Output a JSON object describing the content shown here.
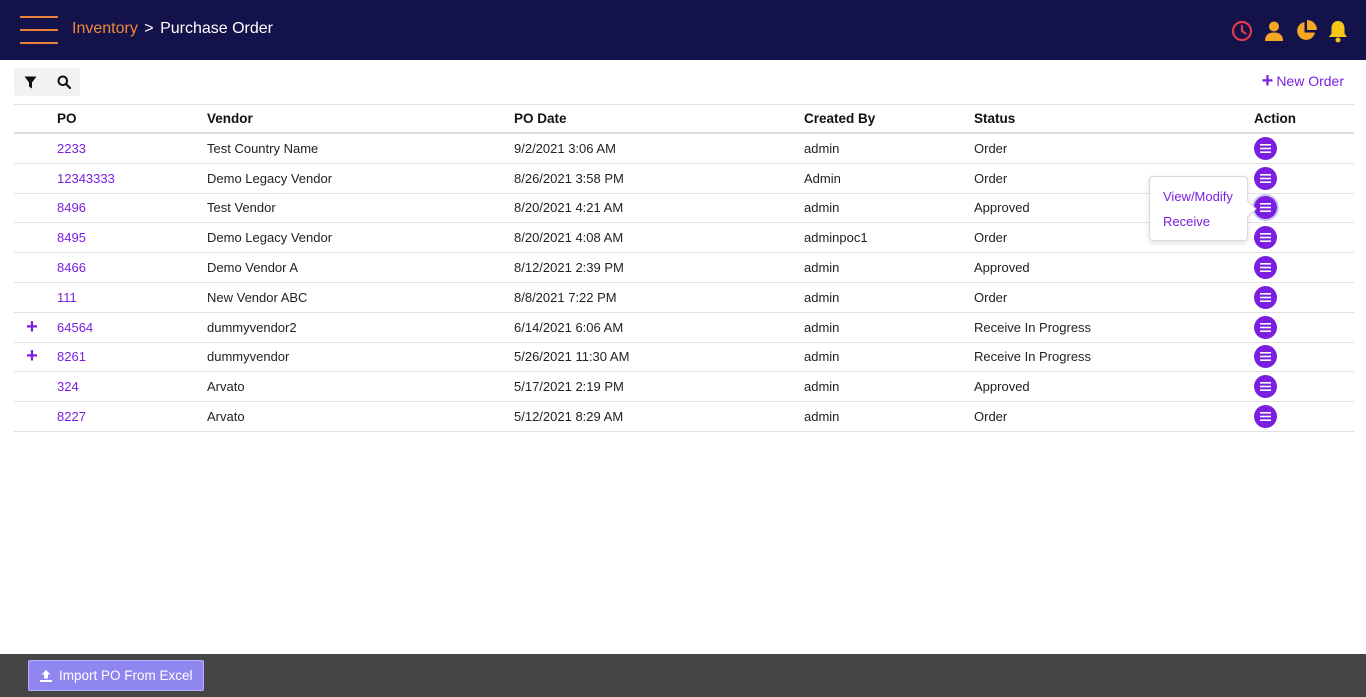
{
  "header": {
    "breadcrumb_parent": "Inventory",
    "breadcrumb_separator": ">",
    "breadcrumb_current": "Purchase Order",
    "icons": [
      "clock-icon",
      "user-icon",
      "pie-chart-icon",
      "bell-icon"
    ]
  },
  "toolbar": {
    "filter_icon": "filter-icon",
    "search_icon": "search-icon",
    "new_order_label": "New Order"
  },
  "table": {
    "columns": [
      "PO",
      "Vendor",
      "PO Date",
      "Created By",
      "Status",
      "Action"
    ],
    "rows": [
      {
        "po": "2233",
        "vendor": "Test Country Name",
        "date": "9/2/2021 3:06 AM",
        "created_by": "admin",
        "status": "Order",
        "expandable": false
      },
      {
        "po": "12343333",
        "vendor": "Demo Legacy Vendor",
        "date": "8/26/2021 3:58 PM",
        "created_by": "Admin",
        "status": "Order",
        "expandable": false
      },
      {
        "po": "8496",
        "vendor": "Test Vendor",
        "date": "8/20/2021 4:21 AM",
        "created_by": "admin",
        "status": "Approved",
        "expandable": false
      },
      {
        "po": "8495",
        "vendor": "Demo Legacy Vendor",
        "date": "8/20/2021 4:08 AM",
        "created_by": "adminpoc1",
        "status": "Order",
        "expandable": false
      },
      {
        "po": "8466",
        "vendor": "Demo Vendor A",
        "date": "8/12/2021 2:39 PM",
        "created_by": "admin",
        "status": "Approved",
        "expandable": false
      },
      {
        "po": "111",
        "vendor": "New Vendor ABC",
        "date": "8/8/2021 7:22 PM",
        "created_by": "admin",
        "status": "Order",
        "expandable": false
      },
      {
        "po": "64564",
        "vendor": "dummyvendor2",
        "date": "6/14/2021 6:06 AM",
        "created_by": "admin",
        "status": "Receive In Progress",
        "expandable": true
      },
      {
        "po": "8261",
        "vendor": "dummyvendor",
        "date": "5/26/2021 11:30 AM",
        "created_by": "admin",
        "status": "Receive In Progress",
        "expandable": true
      },
      {
        "po": "324",
        "vendor": "Arvato",
        "date": "5/17/2021 2:19 PM",
        "created_by": "admin",
        "status": "Approved",
        "expandable": false
      },
      {
        "po": "8227",
        "vendor": "Arvato",
        "date": "5/12/2021 8:29 AM",
        "created_by": "admin",
        "status": "Order",
        "expandable": false
      }
    ]
  },
  "action_menu": {
    "open_row_index": 2,
    "items": [
      "View/Modify",
      "Receive"
    ]
  },
  "footer": {
    "import_label": "Import PO From Excel"
  },
  "colors": {
    "header_bg": "#13124a",
    "accent_orange": "#f08a3a",
    "accent_purple": "#7a1fe0",
    "clock_red": "#e23a4a",
    "footer_bg": "#454545",
    "import_button": "#8f86f0"
  }
}
